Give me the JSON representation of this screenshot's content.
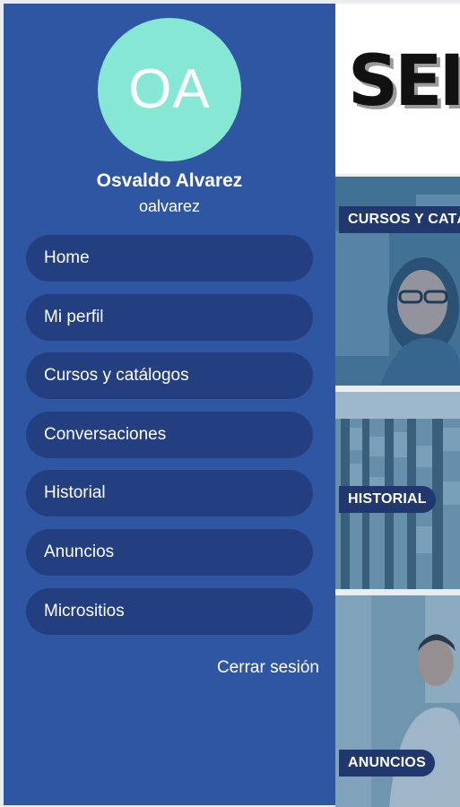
{
  "hero": {
    "title": "SEI"
  },
  "tiles": [
    {
      "label": "CURSOS Y CATÁLOGOS",
      "image": "student-with-glasses-photo"
    },
    {
      "label": "HISTORIAL",
      "image": "library-shelves-photo"
    },
    {
      "label": "ANUNCIOS",
      "image": "man-at-office-photo"
    }
  ],
  "drawer": {
    "avatar_initials": "OA",
    "user_name": "Osvaldo Alvarez",
    "username": "oalvarez",
    "menu": [
      {
        "label": "Home"
      },
      {
        "label": "Mi perfil"
      },
      {
        "label": "Cursos y catálogos"
      },
      {
        "label": "Conversaciones"
      },
      {
        "label": "Historial"
      },
      {
        "label": "Anuncios"
      },
      {
        "label": "Micrositios"
      }
    ],
    "logout_label": "Cerrar sesión"
  },
  "colors": {
    "drawer_bg": "#2f56a3",
    "menu_item_bg": "#243f80",
    "avatar_bg": "#86e8d4",
    "tile_label_bg": "#20386e"
  }
}
